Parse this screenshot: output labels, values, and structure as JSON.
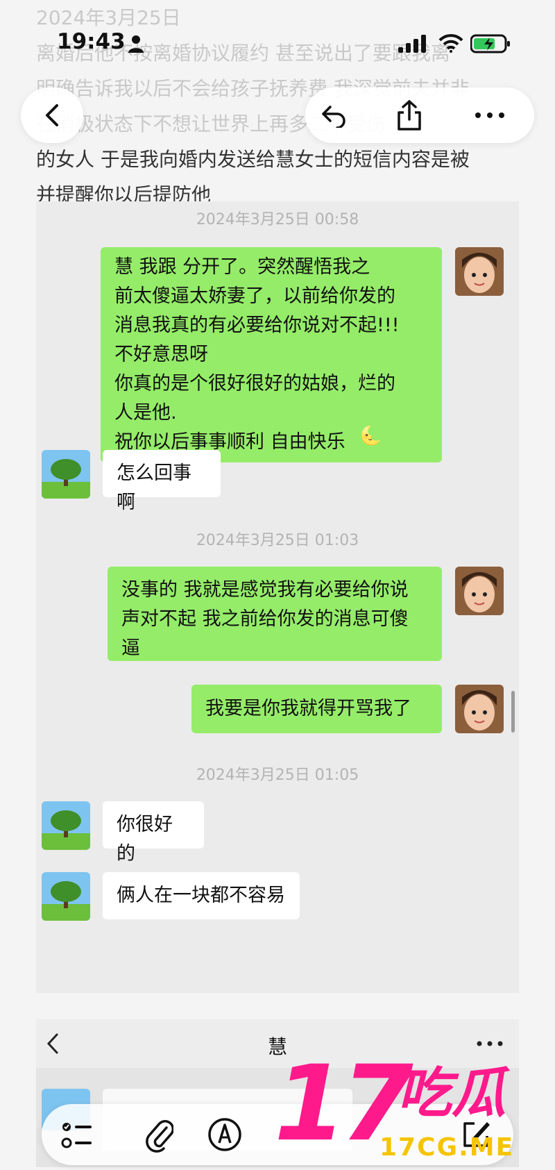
{
  "document": {
    "lines": [
      "2024年3月25日",
      "离婚后他不按离婚协议履约 甚至说出了要跟我离",
      "明确告诉我以后不会给孩子抚养费 我深觉前夫并非",
      "在消极状态下不想让世界上再多二个受伤",
      "的女人 于是我向婚内发送给慧女士的短信内容是被",
      "并提醒你以后提防他"
    ]
  },
  "status_bar": {
    "time": "19:43"
  },
  "toolbar": {
    "back_icon": "chevron-left-icon",
    "undo_icon": "undo-icon",
    "share_icon": "share-icon",
    "more_icon": "more-icon"
  },
  "chat": {
    "timestamps": [
      "2024年3月25日 00:58",
      "2024年3月25日 01:03",
      "2024年3月25日 01:05"
    ],
    "messages": [
      {
        "side": "right",
        "text": "慧 我跟    分开了。突然醒悟我之\n前太傻逼太娇妻了，以前给你发的\n消息我真的有必要给你说对不起!!!\n不好意思呀\n你真的是个很好很好的姑娘，烂的\n人是他.\n祝你以后事事顺利 自由快乐"
      },
      {
        "side": "left",
        "text": "怎么回事啊"
      },
      {
        "side": "right",
        "text": "没事的 我就是感觉我有必要给你说\n声对不起 我之前给你发的消息可傻\n逼"
      },
      {
        "side": "right",
        "text": "我要是你我就得开骂我了"
      },
      {
        "side": "left",
        "text": "你很好的"
      },
      {
        "side": "left",
        "text": "俩人在一块都不容易"
      }
    ]
  },
  "chat2": {
    "title": "慧",
    "more_icon": "more-icon"
  },
  "watermark": {
    "number": "17",
    "name": "吃瓜",
    "url": "17CG.ME"
  },
  "colors": {
    "green_bubble": "#95ec69",
    "watermark_pink": "#ff1a8c",
    "watermark_yellow": "#f5c400"
  }
}
